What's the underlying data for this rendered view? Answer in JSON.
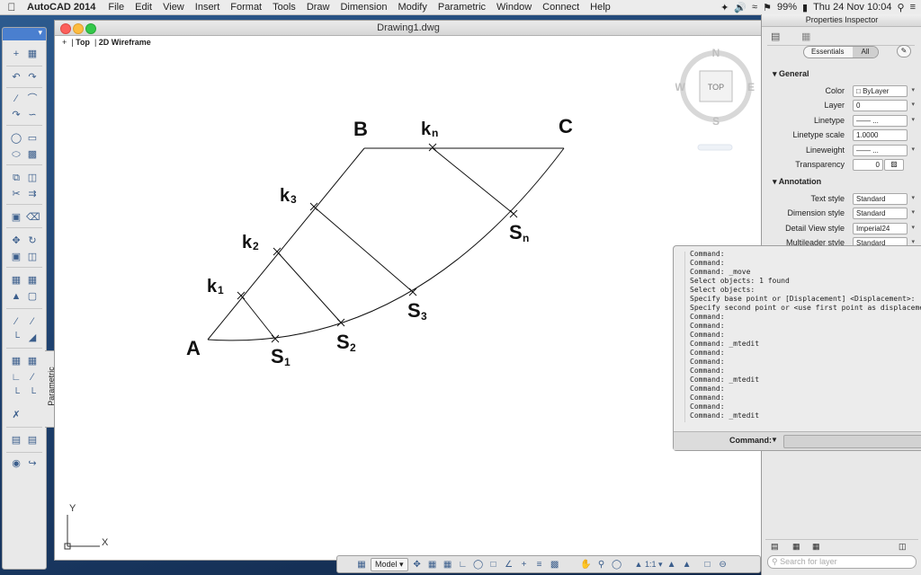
{
  "menubar": {
    "app_name": "AutoCAD 2014",
    "items": [
      "File",
      "Edit",
      "View",
      "Insert",
      "Format",
      "Tools",
      "Draw",
      "Dimension",
      "Modify",
      "Parametric",
      "Window",
      "Connect",
      "Help"
    ],
    "battery": "99%",
    "datetime": "Thu 24 Nov  10:04"
  },
  "window": {
    "title": "Drawing1.dwg",
    "viewport_plus": "+",
    "viewport_view": "Top",
    "viewport_style": "2D Wireframe"
  },
  "palette": {
    "parametric_tab": "Parametric"
  },
  "viewcube": {
    "north": "N",
    "south": "S",
    "east": "E",
    "west": "W",
    "face": "TOP"
  },
  "drawing": {
    "labels": {
      "A": "A",
      "B": "B",
      "C": "C",
      "k1": "k",
      "k1_sub": "1",
      "k2": "k",
      "k2_sub": "2",
      "k3": "k",
      "k3_sub": "3",
      "kn": "k",
      "kn_sub": "n",
      "s1": "S",
      "s1_sub": "1",
      "s2": "S",
      "s2_sub": "2",
      "s3": "S",
      "s3_sub": "3",
      "sn": "S",
      "sn_sub": "n"
    },
    "ucs_x": "X",
    "ucs_y": "Y"
  },
  "properties": {
    "title": "Properties Inspector",
    "tab_essentials": "Essentials",
    "tab_all": "All",
    "general_header": "General",
    "rows": [
      {
        "label": "Color",
        "value": "ByLayer"
      },
      {
        "label": "Layer",
        "value": "0"
      },
      {
        "label": "Linetype",
        "value": "—— ..."
      },
      {
        "label": "Linetype scale",
        "value": "1.0000"
      },
      {
        "label": "Lineweight",
        "value": "—— ..."
      },
      {
        "label": "Transparency",
        "value": "0"
      }
    ],
    "annotation_header": "Annotation",
    "annotation_rows": [
      {
        "label": "Text style",
        "value": "Standard"
      },
      {
        "label": "Dimension style",
        "value": "Standard"
      },
      {
        "label": "Detail View style",
        "value": "Imperial24"
      },
      {
        "label": "Multileader style",
        "value": "Standard"
      }
    ],
    "search_placeholder": "Search for layer"
  },
  "command_window": {
    "log": [
      "Command:",
      "Command:",
      "Command: _move",
      "Select objects: 1 found",
      "Select objects:",
      "Specify base point or [Displacement] <Displacement>:",
      "Specify second point or <use first point as displacement>:",
      "Command:",
      "Command:",
      "Command:",
      "Command: _mtedit",
      "Command:",
      "Command:",
      "Command:",
      "Command: _mtedit",
      "Command:",
      "Command:",
      "Command:",
      "Command: _mtedit"
    ],
    "prompt": "Command:"
  },
  "statusbar": {
    "model_label": "Model",
    "scale": "1:1"
  }
}
